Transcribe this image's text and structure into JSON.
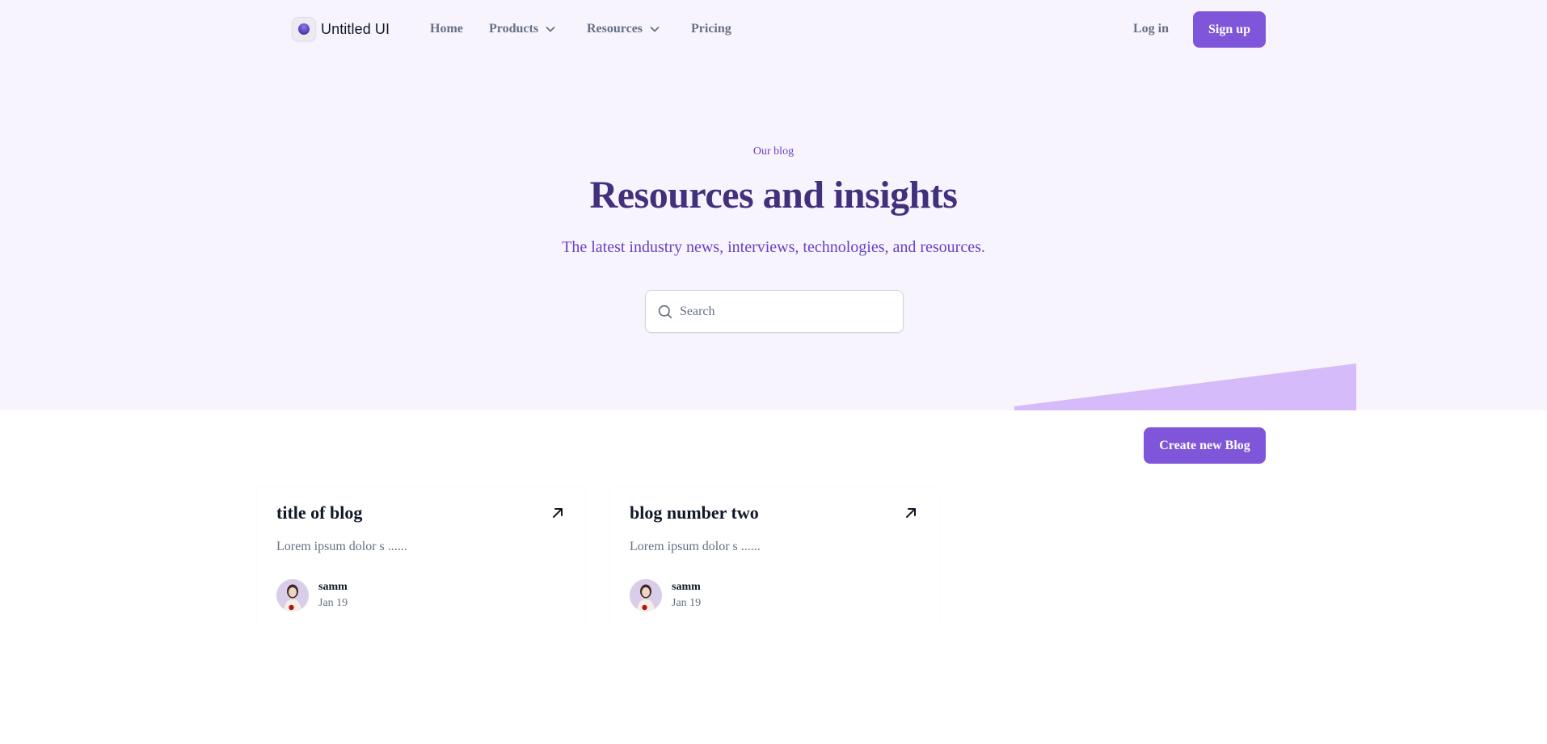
{
  "nav": {
    "brand": "Untitled UI",
    "links": [
      {
        "label": "Home",
        "has_dropdown": false
      },
      {
        "label": "Products",
        "has_dropdown": true
      },
      {
        "label": "Resources",
        "has_dropdown": true
      },
      {
        "label": "Pricing",
        "has_dropdown": false
      }
    ],
    "login_label": "Log in",
    "signup_label": "Sign up"
  },
  "hero": {
    "eyebrow": "Our blog",
    "title": "Resources and insights",
    "subtitle": "The latest industry news, interviews, technologies, and resources.",
    "search": {
      "placeholder": "Search",
      "value": ""
    }
  },
  "actions": {
    "create_label": "Create new Blog"
  },
  "posts": [
    {
      "title": "title of blog",
      "excerpt": "Lorem ipsum dolor s ......",
      "author": "samm",
      "date": "Jan 19"
    },
    {
      "title": "blog number two",
      "excerpt": "Lorem ipsum dolor s ......",
      "author": "samm",
      "date": "Jan 19"
    }
  ],
  "icons": {
    "logo": "logo-icon",
    "dropdown": "chevron-down-icon",
    "search": "search-icon",
    "card_link": "arrow-up-right-icon",
    "avatar": "avatar-photo"
  },
  "colors": {
    "primary": "#7f56d9",
    "hero_background": "#f7f4fd",
    "heading": "#42307d",
    "accent_text": "#6941c6",
    "muted_text": "#667085",
    "decor_wedge": "#d6bbfb"
  }
}
